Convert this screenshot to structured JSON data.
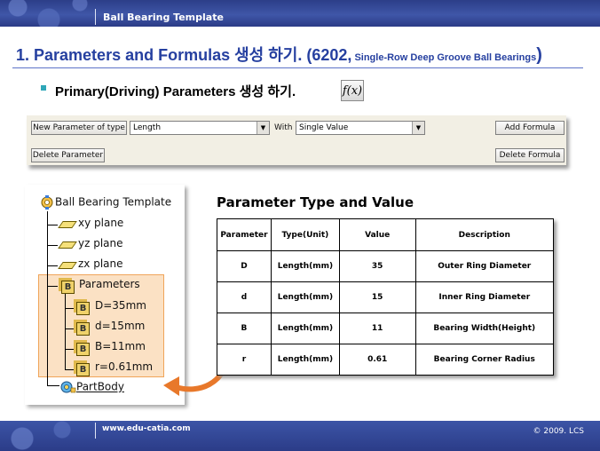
{
  "header": {
    "title": "Ball Bearing Template"
  },
  "heading": {
    "main": "1. Parameters and Formulas 생성 하기. (6202,",
    "small": " Single-Row Deep Groove Ball Bearings",
    "close": ")"
  },
  "subheading": {
    "text": "Primary(Driving) Parameters 생성 하기.",
    "fx_icon": "f(x)"
  },
  "toolbar": {
    "new_param_label": "New Parameter of type",
    "type_value": "Length",
    "with_label": "With",
    "with_value": "Single Value",
    "add_formula": "Add Formula",
    "delete_parameter": "Delete Parameter",
    "delete_formula": "Delete Formula"
  },
  "tree": {
    "root": "Ball Bearing Template",
    "xy": "xy plane",
    "yz": "yz plane",
    "zx": "zx plane",
    "parameters": "Parameters",
    "params": [
      "D=35mm",
      "d=15mm",
      "B=11mm",
      "r=0.61mm"
    ],
    "partbody": "PartBody"
  },
  "table": {
    "title": "Parameter Type and Value",
    "headers": [
      "Parameter",
      "Type(Unit)",
      "Value",
      "Description"
    ],
    "rows": [
      [
        "D",
        "Length(mm)",
        "35",
        "Outer Ring Diameter"
      ],
      [
        "d",
        "Length(mm)",
        "15",
        "Inner Ring Diameter"
      ],
      [
        "B",
        "Length(mm)",
        "11",
        "Bearing Width(Height)"
      ],
      [
        "r",
        "Length(mm)",
        "0.61",
        "Bearing Corner Radius"
      ]
    ]
  },
  "footer": {
    "url": "www.edu-catia.com",
    "copyright": "© 2009. LCS"
  },
  "colors": {
    "heading": "#2640a0",
    "highlight": "#fbe1c4",
    "arrow": "#e8782a",
    "bar": "#33479a"
  }
}
